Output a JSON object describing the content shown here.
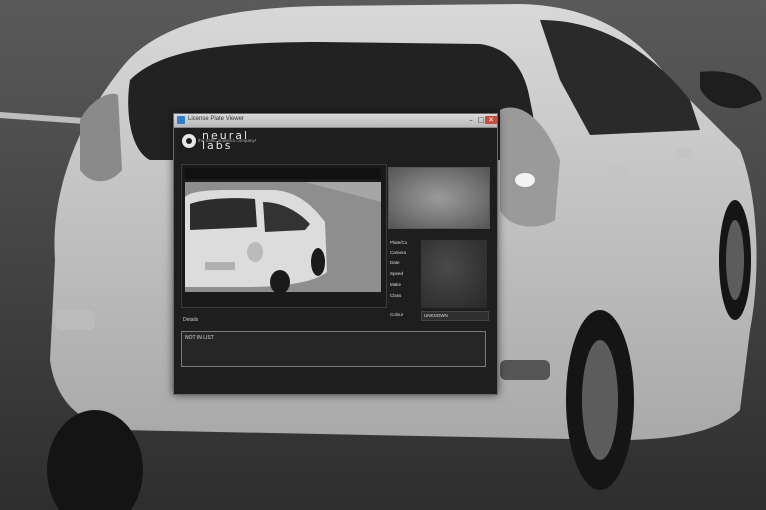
{
  "window": {
    "title": "License Plate Viewer",
    "controls": {
      "minimize": "–",
      "maximize": "□",
      "close": "✕"
    }
  },
  "logo": {
    "line1": "neural",
    "line2": "labs",
    "tagline": "the traffic analytics company!"
  },
  "info": {
    "fields": [
      "Plate/Co",
      "Camera",
      "Date",
      "Speed",
      "Make",
      "Class",
      "Colour"
    ],
    "colour_value": "UNKNOWN"
  },
  "details": {
    "label": "Details",
    "text": "NOT IN LIST"
  },
  "icons": {
    "app": "app-icon",
    "logo": "neural-labs-logo-mark"
  },
  "colors": {
    "window_bg": "#1e1e1e",
    "panel_border": "#7a7a7a",
    "close_button": "#c94a3a"
  }
}
